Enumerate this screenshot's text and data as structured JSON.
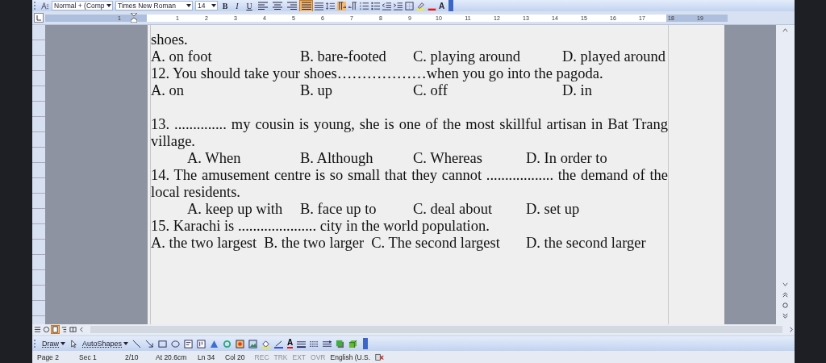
{
  "toolbar": {
    "style": "Normal + (Comp",
    "font": "Times New Roman",
    "size": "14",
    "bold": "B",
    "italic": "I",
    "underline": "U",
    "alignment": [
      {
        "kind": "left",
        "selected": false
      },
      {
        "kind": "center",
        "selected": false
      },
      {
        "kind": "right",
        "selected": false
      },
      {
        "kind": "justify",
        "selected": true
      }
    ],
    "font_color": "A"
  },
  "ruler": {
    "left_labels": [
      "1"
    ],
    "labels": [
      "1",
      "2",
      "3",
      "4",
      "5",
      "6",
      "7",
      "8",
      "9",
      "10",
      "11",
      "12",
      "13",
      "14",
      "15",
      "16",
      "17"
    ],
    "right_labels": [
      "18",
      "19"
    ]
  },
  "document": {
    "paragraphs": [
      {
        "kind": "text",
        "text": "shoes."
      },
      {
        "kind": "options-wide",
        "options": [
          "A. on foot",
          "B. bare-footed",
          "C. playing around",
          "D. played around"
        ]
      },
      {
        "kind": "text",
        "text": "12. You should take your shoes………………when you go into the pagoda."
      },
      {
        "kind": "options-wide",
        "options": [
          "A. on",
          "B. up",
          "C. off",
          "D. in"
        ]
      },
      {
        "kind": "spaced-text",
        "text": "13. .............. my cousin is young, she is one of the most skillful artisan in Bat Trang village."
      },
      {
        "kind": "options-indented",
        "options": [
          "A. When",
          "B. Although",
          "C. Whereas",
          "D. In order to"
        ]
      },
      {
        "kind": "text",
        "text": "14. The amusement centre is so small that they cannot .................. the demand of the local residents."
      },
      {
        "kind": "options-indented",
        "options": [
          "A. keep up with",
          "B. face up to",
          "C. deal about",
          "D. set up"
        ]
      },
      {
        "kind": "text",
        "text": "15. Karachi is ..................... city in the world population."
      },
      {
        "kind": "options-run",
        "options": [
          "A. the two largest",
          "B. the two larger",
          "C. The second largest",
          "D. the second larger"
        ]
      }
    ]
  },
  "draw_toolbar": {
    "draw": "Draw",
    "autoshapes": "AutoShapes",
    "font_color": "A"
  },
  "status_bar": {
    "items": [
      {
        "text": "Page 2",
        "disabled": false
      },
      {
        "text": "Sec 1",
        "disabled": false
      },
      {
        "text": "2/10",
        "disabled": false
      },
      {
        "text": "At 20.6cm",
        "disabled": false
      },
      {
        "text": "Ln 34",
        "disabled": false
      },
      {
        "text": "Col 20",
        "disabled": false
      },
      {
        "text": "REC",
        "disabled": true
      },
      {
        "text": "TRK",
        "disabled": true
      },
      {
        "text": "EXT",
        "disabled": true
      },
      {
        "text": "OVR",
        "disabled": true
      },
      {
        "text": "English (U.S.",
        "disabled": false
      }
    ]
  }
}
